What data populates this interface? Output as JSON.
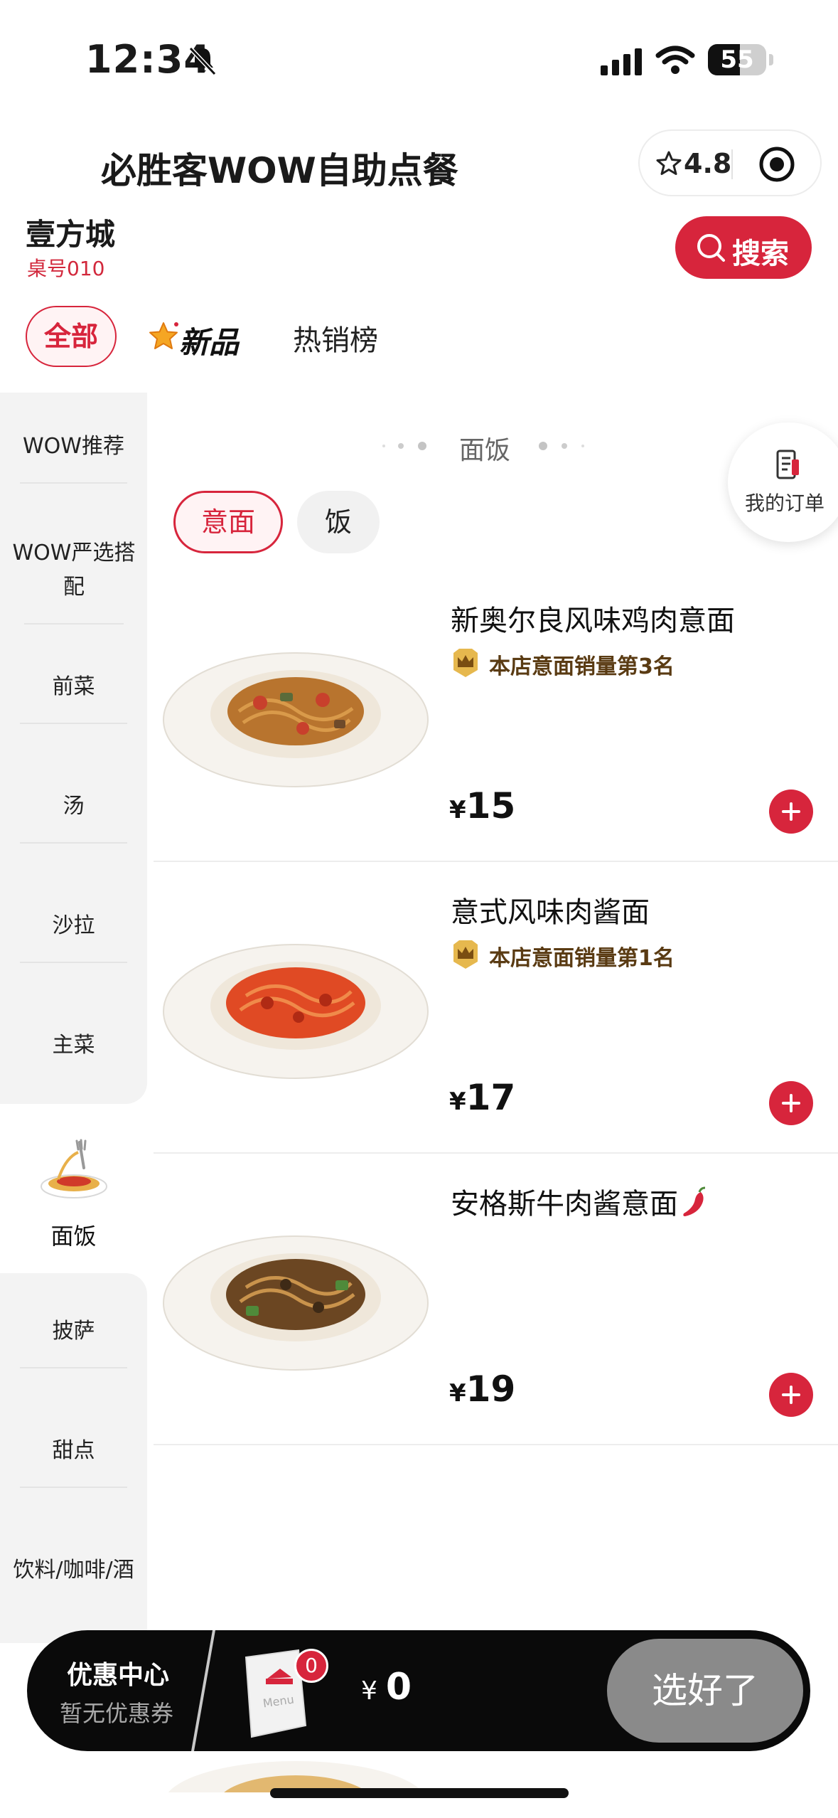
{
  "status_bar": {
    "time": "12:34",
    "battery": "55",
    "battery_level": 0.55
  },
  "header": {
    "title": "必胜客WOW自助点餐",
    "rating": "4.8",
    "store_name": "壹方城",
    "table_no": "桌号010",
    "search_label": "搜索"
  },
  "top_tabs": {
    "all": "全部",
    "new": "新品",
    "hot": "热销榜"
  },
  "sidebar": {
    "items": [
      "WOW推荐",
      "WOW严选搭配",
      "前菜",
      "汤",
      "沙拉",
      "主菜",
      "面饭",
      "披萨",
      "甜点",
      "饮料/咖啡/酒"
    ],
    "active": "面饭"
  },
  "section": {
    "title": "面饭",
    "chips": [
      "意面",
      "饭"
    ],
    "my_order": "我的订单"
  },
  "products": [
    {
      "name": "",
      "badge": "",
      "price": "15"
    },
    {
      "name": "新奥尔良风味鸡肉意面",
      "badge": "本店意面销量第3名",
      "price": "15"
    },
    {
      "name": "意式风味肉酱面",
      "badge": "本店意面销量第1名",
      "price": "17"
    },
    {
      "name": "安格斯牛肉酱意面",
      "badge": "",
      "price": "19",
      "spicy": true
    }
  ],
  "currency": "¥",
  "cart": {
    "coupon_title": "优惠中心",
    "coupon_sub": "暂无优惠券",
    "count": "0",
    "currency": "¥",
    "total": "0",
    "checkout": "选好了"
  },
  "colors": {
    "accent": "#d7253c",
    "sidebar_bg": "#f3f3f3",
    "cart_bg": "#0a0a0a"
  }
}
